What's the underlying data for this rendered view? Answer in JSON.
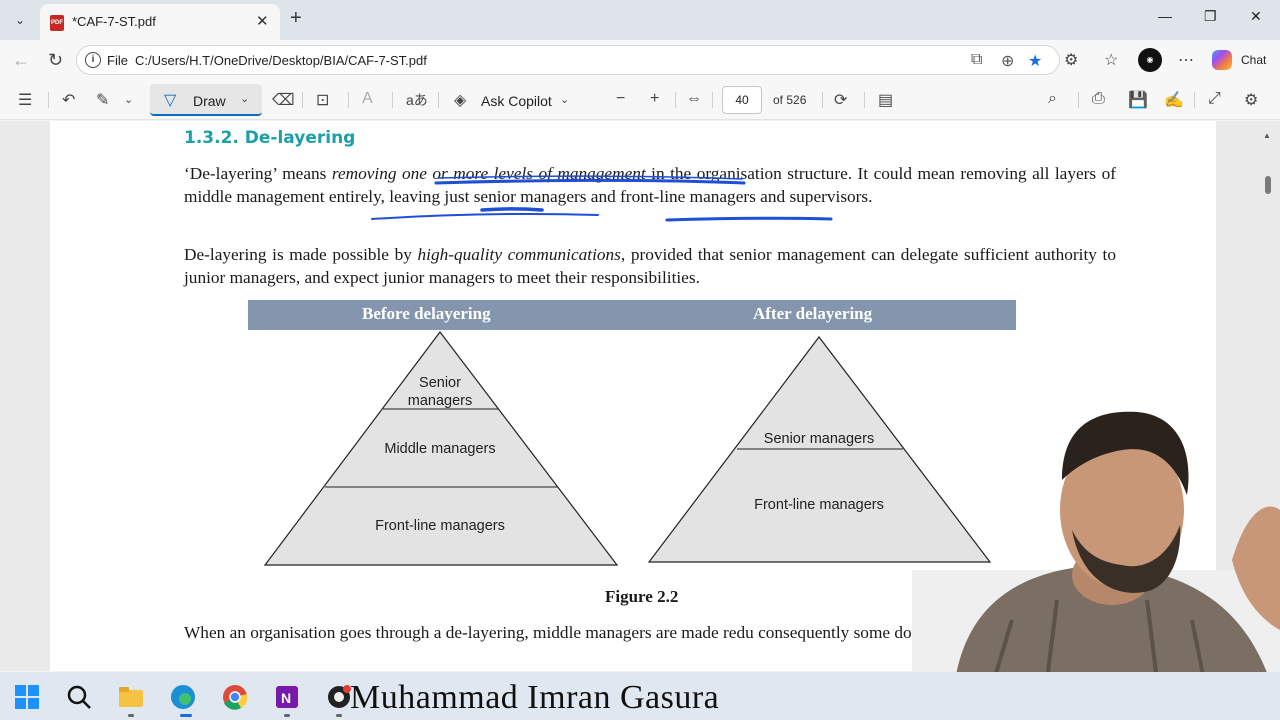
{
  "browser": {
    "tab_title": "*CAF-7-ST.pdf",
    "tab_badge": "PDF",
    "new_tab": "+",
    "close_tab": "✕",
    "address": {
      "scheme_label": "File",
      "url": "C:/Users/H.T/OneDrive/Desktop/BIA/CAF-7-ST.pdf"
    },
    "chat_label": "Chat"
  },
  "pdf_toolbar": {
    "draw_label": "Draw",
    "ask_copilot_label": "Ask Copilot",
    "read_aloud_label": "aあ",
    "current_page": "40",
    "page_total": "of 526"
  },
  "document": {
    "section_title": "1.3.2. De-layering",
    "paragraph1": {
      "a": "‘De-layering’ means ",
      "b": "removing one or more levels of management",
      "c": " in the organisation structure. It could mean removing all layers of middle management entirely, leaving just senior managers and front-line managers and supervisors."
    },
    "paragraph2": {
      "a": "De-layering is made possible by ",
      "b": "high-quality communications",
      "c": ", provided that senior management can delegate sufficient authority to junior managers, and expect junior managers to meet their responsibilities."
    },
    "figure": {
      "before_heading": "Before delayering",
      "after_heading": "After delayering",
      "before_levels": [
        "Senior",
        "managers",
        "Middle managers",
        "Front-line managers"
      ],
      "after_levels": [
        "Senior managers",
        "Front-line managers"
      ],
      "caption": "Figure 2.2"
    },
    "paragraph3": "When an organisation goes through a de-layering, middle managers are made redu consequently some downsizing."
  },
  "overlay": {
    "watermark": "Muhammad Imran Gasura"
  },
  "colors": {
    "section_title": "#1aa0a8",
    "figure_header": "#8496ad",
    "ink_annotation": "#1f4fd6",
    "accent": "#0f6cbd"
  }
}
